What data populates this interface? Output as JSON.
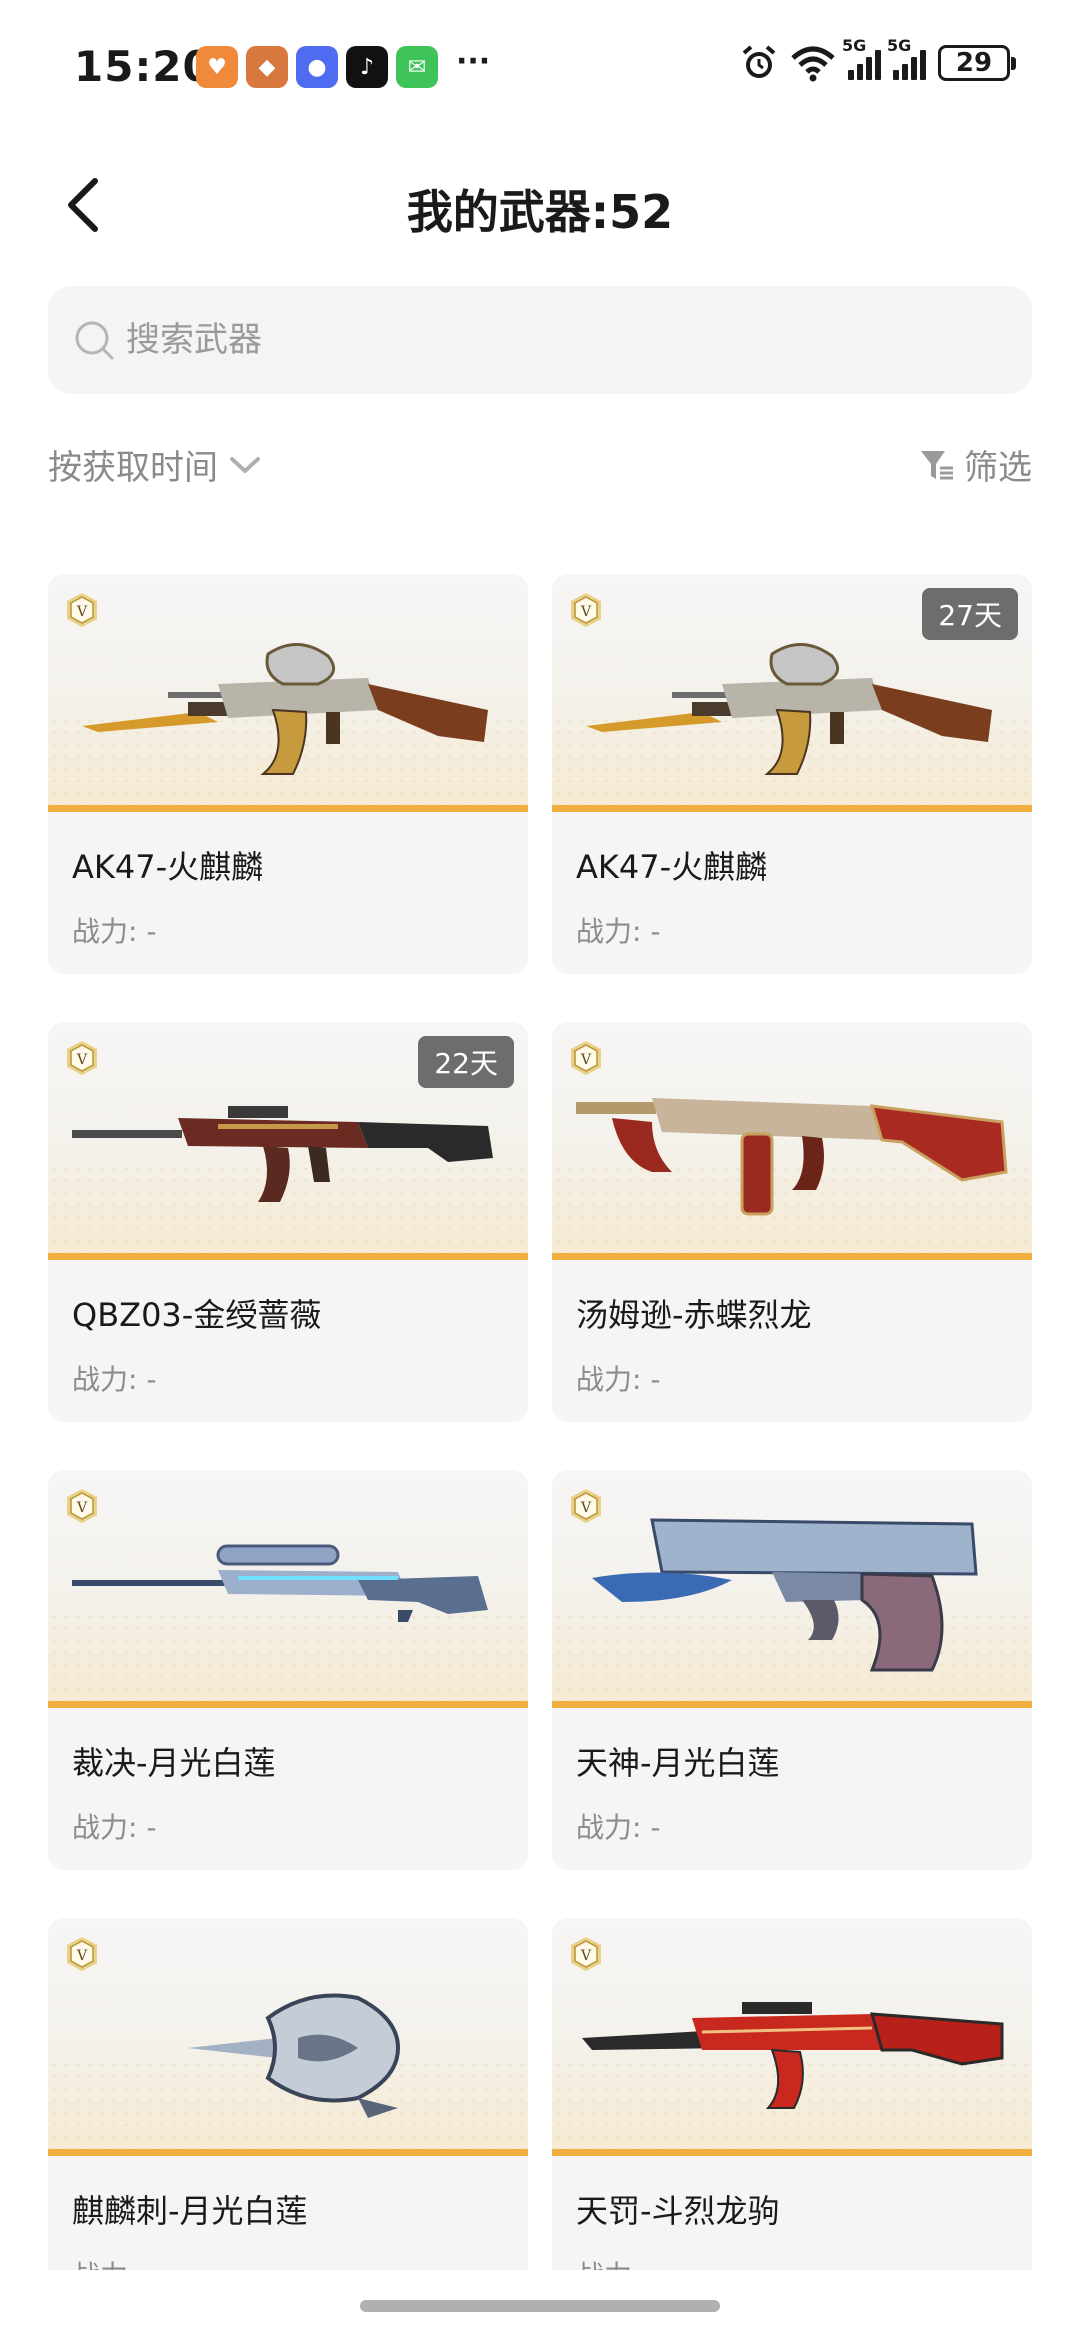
{
  "status_bar": {
    "time": "15:20",
    "more": "···",
    "battery": "29",
    "network_labels": [
      "5G",
      "5G"
    ]
  },
  "header": {
    "title": "我的武器:52"
  },
  "search": {
    "placeholder": "搜索武器",
    "value": ""
  },
  "sort": {
    "label": "按获取时间"
  },
  "filter": {
    "label": "筛选"
  },
  "power_label": "战力: -",
  "weapons": [
    {
      "name": "AK47-火麒麟",
      "power": "战力: -",
      "days": "",
      "icon": "ak47-fire-qilin-icon"
    },
    {
      "name": "AK47-火麒麟",
      "power": "战力: -",
      "days": "27天",
      "icon": "ak47-fire-qilin-icon"
    },
    {
      "name": "QBZ03-金绶蔷薇",
      "power": "战力: -",
      "days": "22天",
      "icon": "qbz03-rifle-icon"
    },
    {
      "name": "汤姆逊-赤蝶烈龙",
      "power": "战力: -",
      "days": "",
      "icon": "thompson-smg-icon"
    },
    {
      "name": "裁决-月光白莲",
      "power": "战力: -",
      "days": "",
      "icon": "sniper-rifle-icon"
    },
    {
      "name": "天神-月光白莲",
      "power": "战力: -",
      "days": "",
      "icon": "desert-eagle-pistol-icon"
    },
    {
      "name": "麒麟刺-月光白莲",
      "power": "战力: -",
      "days": "",
      "icon": "dagger-icon"
    },
    {
      "name": "天罚-斗烈龙驹",
      "power": "战力: -",
      "days": "",
      "icon": "red-rifle-icon"
    }
  ],
  "colors": {
    "accent_bar": "#f0b040",
    "badge_bg": "#6d6d6d",
    "card_bg": "#f5f5f5"
  }
}
